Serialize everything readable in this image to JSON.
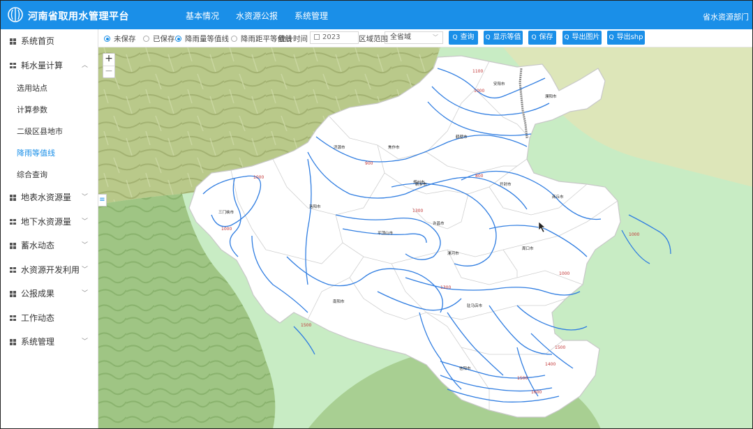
{
  "header": {
    "title": "河南省取用水管理平台",
    "nav": [
      "基本情况",
      "水资源公报",
      "系统管理"
    ],
    "department": "省水资源部门"
  },
  "sidebar": {
    "items": [
      {
        "label": "系统首页"
      },
      {
        "label": "耗水量计算",
        "expanded": true,
        "children": [
          "选用站点",
          "计算参数",
          "二级区县地市",
          "降雨等值线",
          "综合查询"
        ]
      },
      {
        "label": "地表水资源量"
      },
      {
        "label": "地下水资源量"
      },
      {
        "label": "蓄水动态"
      },
      {
        "label": "水资源开发利用"
      },
      {
        "label": "公报成果"
      },
      {
        "label": "工作动态"
      },
      {
        "label": "系统管理"
      }
    ],
    "active_child": "降雨等值线"
  },
  "toolbar": {
    "radios": [
      {
        "label": "未保存",
        "checked": true
      },
      {
        "label": "已保存",
        "checked": false
      },
      {
        "label": "降雨量等值线",
        "checked": true
      },
      {
        "label": "降雨距平等值线",
        "checked": false
      }
    ],
    "time_label": "统计时间",
    "year_value": "2023",
    "scope_label": "区域范围",
    "scope_value": "全省域",
    "buttons": [
      "查询",
      "显示等值",
      "保存",
      "导出图片",
      "导出shp"
    ]
  },
  "map": {
    "cities": [
      "三门峡市",
      "洛阳市",
      "济源市",
      "焦作市",
      "新乡市",
      "鹤壁市",
      "安阳市",
      "濮阳市",
      "郑州市",
      "开封市",
      "商丘市",
      "许昌市",
      "平顶山市",
      "漯河市",
      "周口市",
      "南阳市",
      "驻马店市",
      "信阳市"
    ],
    "isoline_labels": [
      "1000",
      "1100",
      "1200",
      "1300",
      "1400",
      "1500",
      "1600",
      "800",
      "900"
    ]
  },
  "colors": {
    "accent": "#1a8fe8",
    "isoline": "#2f7de1",
    "isoline_label": "#c03030"
  }
}
